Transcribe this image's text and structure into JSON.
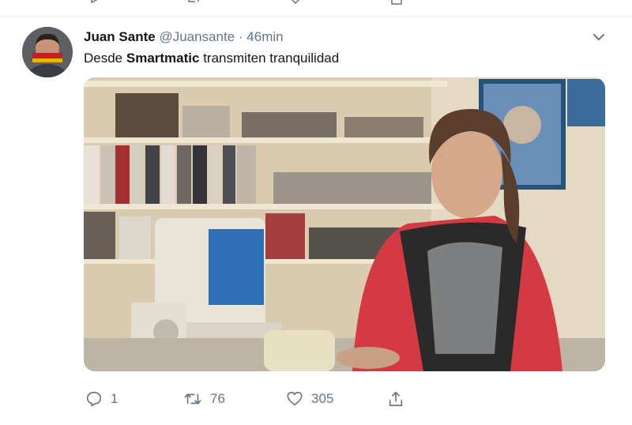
{
  "tweet": {
    "author_name": "Juan Sante",
    "handle": "@Juansante",
    "separator": "·",
    "time": "46min",
    "text_before": "Desde ",
    "text_bold": "Smartmatic",
    "text_after": " transmiten tranquilidad",
    "actions": {
      "reply_count": "1",
      "retweet_count": "76",
      "like_count": "305"
    }
  },
  "colors": {
    "text_primary": "#14171a",
    "text_secondary": "#657786",
    "divider": "#e6ecf0"
  }
}
